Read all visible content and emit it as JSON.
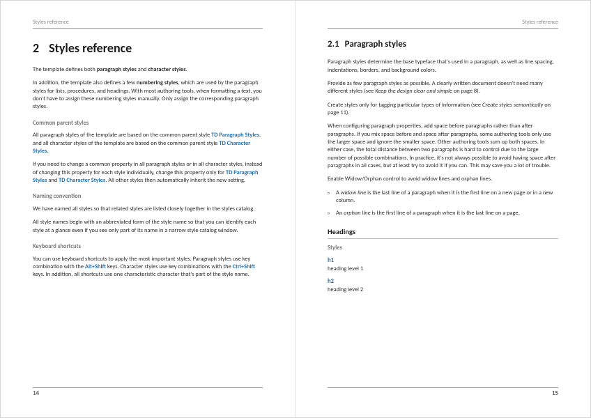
{
  "left": {
    "running_head": "Styles reference",
    "chapter_number": "2",
    "chapter_title": "Styles reference",
    "intro1_a": "The template defines both ",
    "intro1_b": "paragraph styles",
    "intro1_c": " and ",
    "intro1_d": "character styles",
    "intro1_e": ".",
    "intro2_a": "In addition, the template also defines a few ",
    "intro2_b": "numbering styles",
    "intro2_c": ", which are used by the paragraph styles for lists, procedures, and headings. With most authoring tools, when formatting a text, you don't have to assign these numbering styles manually. Only assign the corresponding paragraph styles.",
    "h_common": "Common parent styles",
    "common1_a": "All paragraph styles of the template are based on the common parent style ",
    "common1_b": "TD Paragraph Styles",
    "common1_c": ", and all character styles of the template are based on the common parent style ",
    "common1_d": "TD Character Styles",
    "common1_e": ".",
    "common2_a": "If you need to change a common property in all paragraph styles or in all character styles, instead of changing this property for each style individually, change this property only for ",
    "common2_b": "TD Paragraph Styles",
    "common2_c": " and ",
    "common2_d": "TD Character Styles",
    "common2_e": ". All other styles then automatically inherit the new setting.",
    "h_naming": "Naming convention",
    "naming1": "We have named all styles so that related styles are listed closely together in the styles catalog.",
    "naming2": "All style names begin with an abbreviated form of the style name so that you can identify each style at a glance even if you see only part of its name in a narrow style catalog window.",
    "h_keys": "Keyboard shortcuts",
    "keys1_a": "You can use keyboard shortcuts to apply the most important styles. Paragraph styles use key combination with the ",
    "keys1_b": "Alt+Shift",
    "keys1_c": " keys. Character styles use key combinations with the ",
    "keys1_d": "Ctrl+Shift",
    "keys1_e": " keys. In addition, all shortcuts use one characteristic character that's part of the style name.",
    "page_number": "14"
  },
  "right": {
    "running_head": "Styles reference",
    "section_number": "2.1",
    "section_title": "Paragraph styles",
    "p1": "Paragraph styles determine the base typeface that's used in a paragraph, as well as line spacing, indentations, borders, and background colors.",
    "p2_a": "Provide as few paragraph styles as possible. A clearly written document doesn't need many different styles (see ",
    "p2_b": "Keep the design clear and simple",
    "p2_c": " on page 8).",
    "p3_a": "Create styles only for tagging particular types of information (see ",
    "p3_b": "Create styles semantically",
    "p3_c": " on page 11).",
    "p4": "When configuring paragraph properties, add space before paragraphs rather than after paragraphs. If you mix space before and space after paragraphs, some authoring tools only use the larger space and ignore the smaller space. Other authoring tools sum up both spaces. In either case, the total distance between two paragraphs is hard to control due to the large number of possible combinations. In practice, it's not always possible to avoid having space after paragraphs in all cases, but at least try to avoid it if you can. This may save you a lot of trouble.",
    "p5": "Enable Widow/Orphan control to avoid widow lines and orphan lines.",
    "li1_a": "A ",
    "li1_b": "widow line",
    "li1_c": " is the last line of a paragraph when it is the first line on a new page or in a new column.",
    "li2_a": "An ",
    "li2_b": "orphan line",
    "li2_c": " is the first line of a paragraph when it is the last line on a page.",
    "h_headings": "Headings",
    "h_styles": "Styles",
    "style1_name": "h1",
    "style1_desc": "heading level 1",
    "style2_name": "h2",
    "style2_desc": "heading level 2",
    "page_number": "15"
  }
}
